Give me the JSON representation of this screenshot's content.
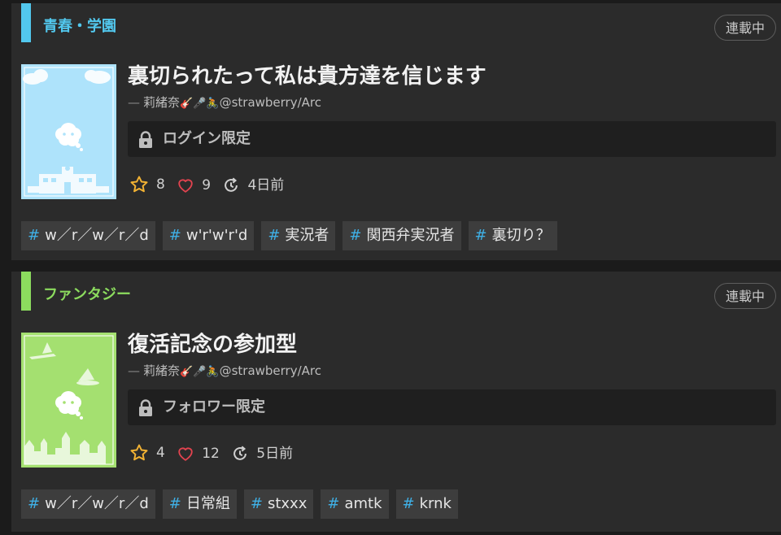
{
  "works": [
    {
      "genre": "青春・学園",
      "genre_color": "#52c8ee",
      "status": "連載中",
      "cover_theme": "school",
      "cover_color": "#aee3fb",
      "title": "裏切られたって私は貴方達を信じます",
      "author": "莉緒奈",
      "author_deco": "🎸🎤🚴",
      "author_handle": "@strawberry/Arc",
      "restriction": "ログイン限定",
      "stars": "8",
      "hearts": "9",
      "updated": "4日前",
      "tags": [
        "w／r／w／r／d",
        "w'r'w'r'd",
        "実況者",
        "関西弁実況者",
        "裏切り？"
      ]
    },
    {
      "genre": "ファンタジー",
      "genre_color": "#8cdc5e",
      "status": "連載中",
      "cover_theme": "fantasy",
      "cover_color": "#a4e070",
      "title": "復活記念の参加型",
      "author": "莉緒奈",
      "author_deco": "🎸🎤🚴",
      "author_handle": "@strawberry/Arc",
      "restriction": "フォロワー限定",
      "stars": "4",
      "hearts": "12",
      "updated": "5日前",
      "tags": [
        "w／r／w／r／d",
        "日常組",
        "stxxx",
        "amtk",
        "krnk"
      ]
    }
  ],
  "icons": {
    "tag": "hash-icon",
    "lock": "lock-icon",
    "star": "star-icon",
    "heart": "heart-icon",
    "updated": "refresh-icon"
  }
}
